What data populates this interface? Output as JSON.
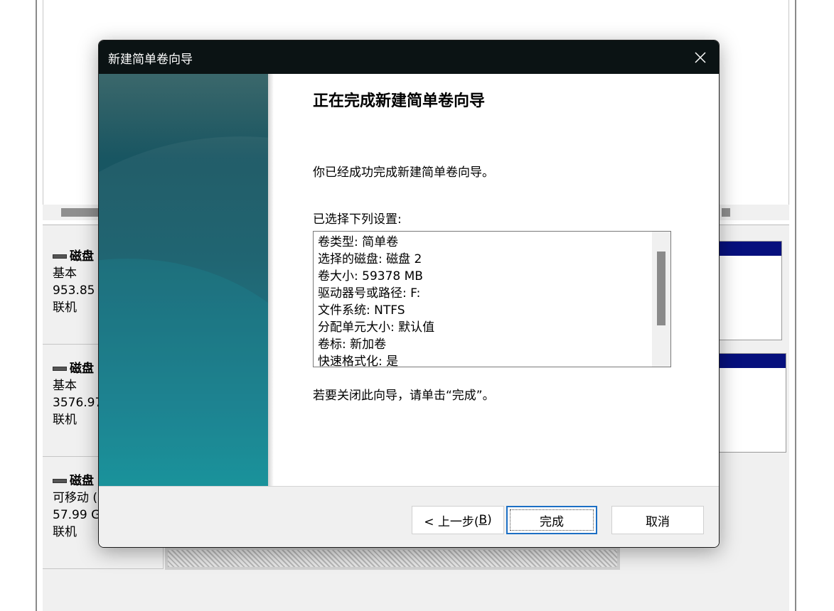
{
  "background_window": {
    "disks": [
      {
        "name": "磁盘",
        "type": "基本",
        "size": "953.85 G",
        "status": "联机"
      },
      {
        "name": "磁盘",
        "type": "基本",
        "size": "3576.97",
        "status": "联机"
      },
      {
        "name": "磁盘",
        "type": "可移动 (",
        "size": "57.99 G",
        "status": "联机"
      }
    ]
  },
  "wizard": {
    "title": "新建简单卷向导",
    "heading": "正在完成新建简单卷向导",
    "success_text": "你已经成功完成新建简单卷向导。",
    "settings_label": "已选择下列设置:",
    "settings": [
      "卷类型: 简单卷",
      "选择的磁盘: 磁盘 2",
      "卷大小: 59378 MB",
      "驱动器号或路径: F:",
      "文件系统: NTFS",
      "分配单元大小: 默认值",
      "卷标: 新加卷",
      "快速格式化: 是"
    ],
    "close_hint": "若要关闭此向导，请单击“完成”。",
    "buttons": {
      "back_prefix": "< 上一步(",
      "back_accel": "B",
      "back_suffix": ")",
      "finish": "完成",
      "cancel": "取消"
    }
  },
  "icons": {
    "close": "close-icon",
    "disk": "disk-icon"
  },
  "colors": {
    "titlebar": "#0b1314",
    "partition_header": "#06107d",
    "focus_border": "#1c6fc4"
  }
}
